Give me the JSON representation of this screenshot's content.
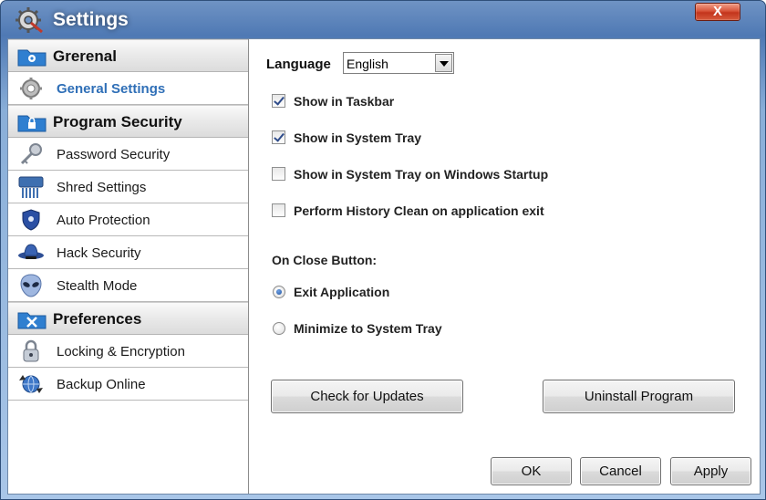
{
  "window": {
    "title": "Settings",
    "close_symbol": "X"
  },
  "sidebar": {
    "categories": [
      {
        "label": "Grerenal",
        "icon": "gear-folder-icon"
      },
      {
        "label": "Program Security",
        "icon": "lock-folder-icon"
      },
      {
        "label": "Preferences",
        "icon": "tools-folder-icon"
      }
    ],
    "items": [
      {
        "label": "General Settings",
        "icon": "gear-icon",
        "active": true
      },
      {
        "label": "Password Security",
        "icon": "key-icon"
      },
      {
        "label": "Shred Settings",
        "icon": "shredder-icon"
      },
      {
        "label": "Auto Protection",
        "icon": "shield-icon"
      },
      {
        "label": "Hack Security",
        "icon": "spy-hat-icon"
      },
      {
        "label": "Stealth Mode",
        "icon": "alien-icon"
      },
      {
        "label": "Locking & Encryption",
        "icon": "padlock-icon"
      },
      {
        "label": "Backup Online",
        "icon": "globe-sync-icon"
      }
    ]
  },
  "content": {
    "language": {
      "label": "Language",
      "value": "English"
    },
    "checkboxes": [
      {
        "label": "Show in Taskbar",
        "checked": true
      },
      {
        "label": "Show in System Tray",
        "checked": true
      },
      {
        "label": "Show in System Tray on Windows Startup",
        "checked": false
      },
      {
        "label": "Perform History Clean on application exit",
        "checked": false
      }
    ],
    "on_close_label": "On Close Button:",
    "radios": [
      {
        "label": "Exit Application",
        "checked": true
      },
      {
        "label": "Minimize to System Tray",
        "checked": false
      }
    ],
    "buttons": {
      "check_updates": "Check for Updates",
      "uninstall": "Uninstall Program",
      "ok": "OK",
      "cancel": "Cancel",
      "apply": "Apply"
    }
  },
  "colors": {
    "active_item": "#2f6fb7",
    "title_bar": "#4f79b4",
    "close_button": "#c3341c"
  }
}
